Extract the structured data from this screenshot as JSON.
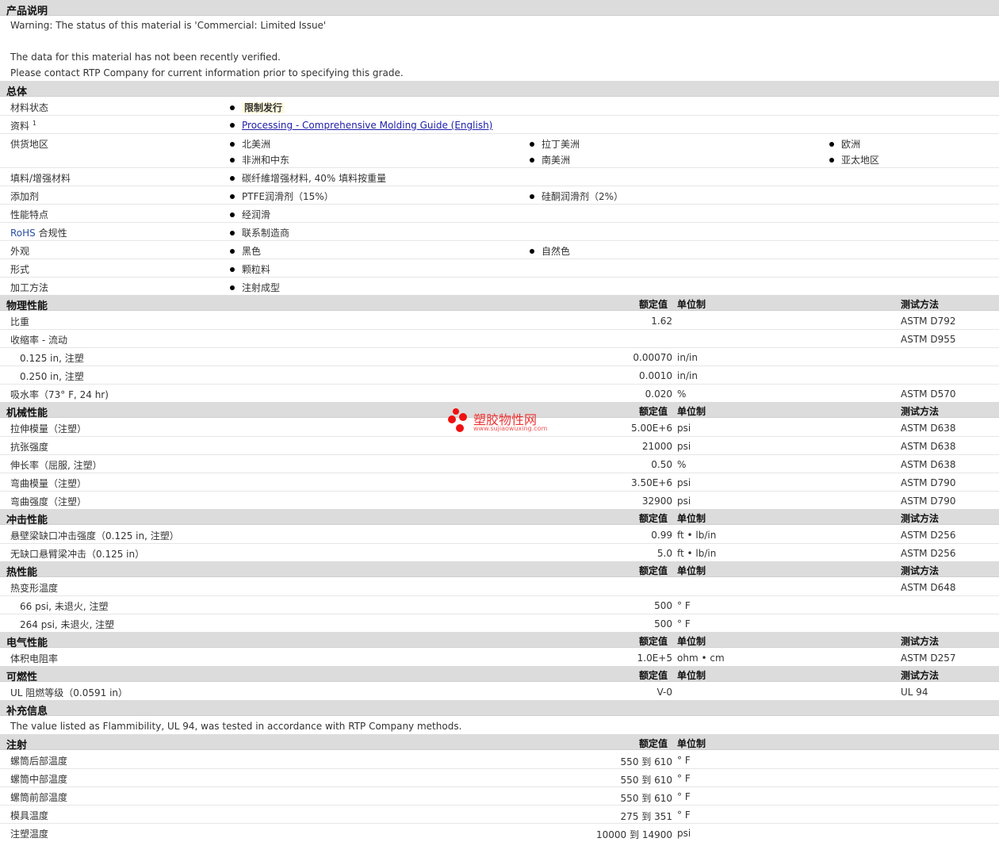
{
  "desc": {
    "title": "产品说明",
    "lines": [
      "Warning: The status of this material is 'Commercial: Limited Issue'",
      "The data for this material has not been recently verified.",
      "Please contact RTP Company for current information prior to specifying this grade."
    ]
  },
  "general": {
    "title": "总体",
    "status": {
      "label": "材料状态",
      "value": "限制发行"
    },
    "doc": {
      "label": "资料",
      "sup": "1",
      "value": "Processing - Comprehensive Molding Guide (English)"
    },
    "region": {
      "label": "供货地区",
      "values": [
        "北美洲",
        "拉丁美洲",
        "欧洲",
        "非洲和中东",
        "南美洲",
        "亚太地区"
      ]
    },
    "filler": {
      "label": "填料/增强材料",
      "value": "碳纤維增强材料, 40% 填料按重量"
    },
    "additive": {
      "label": "添加剂",
      "values": [
        "PTFE润滑剂（15%）",
        "硅酮润滑剂（2%）"
      ]
    },
    "features": {
      "label": "性能特点",
      "value": "经润滑"
    },
    "rohs": {
      "label_prefix": "RoHS",
      "label_suffix": " 合规性",
      "value": "联系制造商"
    },
    "appearance": {
      "label": "外观",
      "values": [
        "黑色",
        "自然色"
      ]
    },
    "form": {
      "label": "形式",
      "value": "颗粒料"
    },
    "processing": {
      "label": "加工方法",
      "value": "注射成型"
    }
  },
  "headers": {
    "nominal": "额定值",
    "unit": "单位制",
    "method": "测试方法"
  },
  "physical": {
    "title": "物理性能",
    "rows": [
      {
        "label": "比重",
        "value": "1.62",
        "unit": "",
        "method": "ASTM D792"
      },
      {
        "label": "收缩率  - 流动",
        "value": "",
        "unit": "",
        "method": "ASTM D955"
      },
      {
        "label": "0.125 in, 注塑",
        "value": "0.00070",
        "unit": "in/in",
        "method": ""
      },
      {
        "label": "0.250 in, 注塑",
        "value": "0.0010",
        "unit": "in/in",
        "method": ""
      },
      {
        "label": "吸水率（73°  F, 24 hr)",
        "value": "0.020",
        "unit": "%",
        "method": "ASTM D570"
      }
    ]
  },
  "mechanical": {
    "title": "机械性能",
    "rows": [
      {
        "label": "拉伸模量（注塑）",
        "value": "5.00E+6",
        "unit": "psi",
        "method": "ASTM D638"
      },
      {
        "label": "抗张强度",
        "value": "21000",
        "unit": "psi",
        "method": "ASTM D638"
      },
      {
        "label": "伸长率（屈服, 注塑）",
        "value": "0.50",
        "unit": "%",
        "method": "ASTM D638"
      },
      {
        "label": "弯曲模量（注塑）",
        "value": "3.50E+6",
        "unit": "psi",
        "method": "ASTM D790"
      },
      {
        "label": "弯曲强度（注塑）",
        "value": "32900",
        "unit": "psi",
        "method": "ASTM D790"
      }
    ]
  },
  "impact": {
    "title": "冲击性能",
    "rows": [
      {
        "label": "悬壁梁缺口冲击强度（0.125 in, 注塑）",
        "value": "0.99",
        "unit": "ft • lb/in",
        "method": "ASTM D256"
      },
      {
        "label": "无缺口悬臂梁冲击（0.125 in）",
        "value": "5.0",
        "unit": "ft • lb/in",
        "method": "ASTM D256"
      }
    ]
  },
  "thermal": {
    "title": "热性能",
    "rows": [
      {
        "label": "热变形温度",
        "value": "",
        "unit": "",
        "method": "ASTM D648"
      },
      {
        "label": "66 psi, 未退火, 注塑",
        "value": "500",
        "unit": "°  F",
        "method": ""
      },
      {
        "label": "264 psi, 未退火, 注塑",
        "value": "500",
        "unit": "°  F",
        "method": ""
      }
    ]
  },
  "electrical": {
    "title": "电气性能",
    "rows": [
      {
        "label": "体积电阻率",
        "value": "1.0E+5",
        "unit": "ohm • cm",
        "method": "ASTM D257"
      }
    ]
  },
  "flammability": {
    "title": "可燃性",
    "rows": [
      {
        "label": "UL 阻燃等级（0.0591 in）",
        "value": "V-0",
        "unit": "",
        "method": "UL 94"
      }
    ]
  },
  "supplement": {
    "title": "补充信息",
    "text": "The value listed as Flammibility, UL 94, was tested in accordance with RTP Company methods."
  },
  "injection": {
    "title": "注射",
    "rows": [
      {
        "label": "螺筒后部温度",
        "value": "550 到  610",
        "unit": "°  F"
      },
      {
        "label": "螺筒中部温度",
        "value": "550 到  610",
        "unit": "°  F"
      },
      {
        "label": "螺筒前部温度",
        "value": "550 到  610",
        "unit": "°  F"
      },
      {
        "label": "模具温度",
        "value": "275 到  351",
        "unit": "°  F"
      },
      {
        "label": "注塑温度",
        "value": "10000 到  14900",
        "unit": "psi"
      }
    ]
  },
  "watermark": {
    "name": "塑胶物性网",
    "url": "www.sujiaowuxing.com"
  }
}
